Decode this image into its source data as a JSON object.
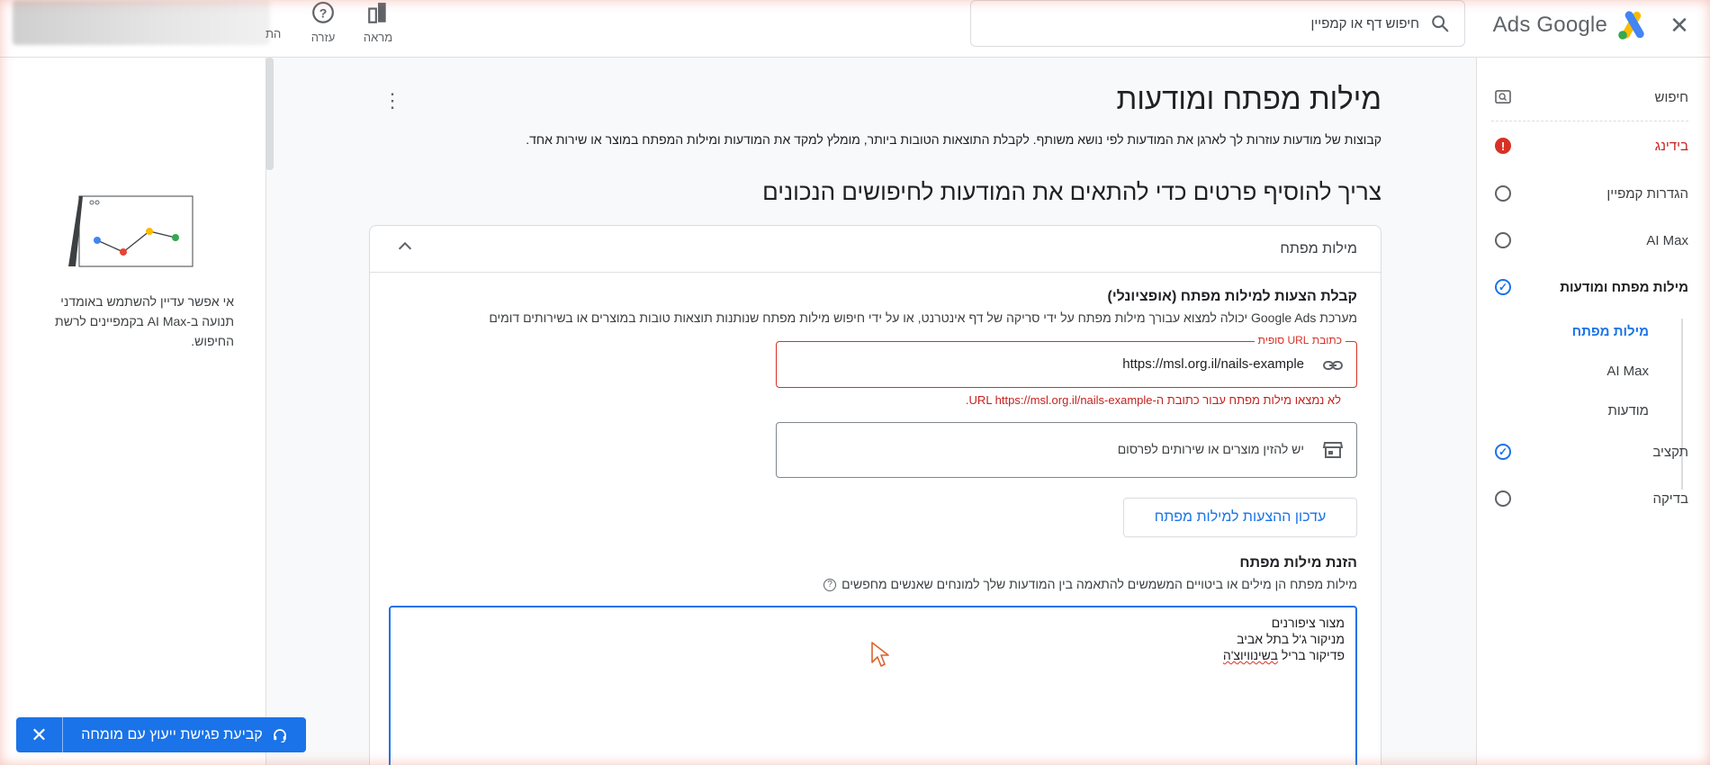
{
  "header": {
    "brand": "Ads Google",
    "search_placeholder": "חיפוש דף או קמפיין",
    "tools": {
      "appearance": "מראה",
      "help": "עזרה",
      "notifications_cut": "הת"
    }
  },
  "nav": {
    "items": [
      {
        "label": "חיפוש",
        "status": "search"
      },
      {
        "label": "בידינג",
        "status": "error"
      },
      {
        "label": "הגדרות קמפיין",
        "status": "empty"
      },
      {
        "label": "AI Max",
        "status": "empty"
      },
      {
        "label": "מילות מפתח ומודעות",
        "status": "done"
      },
      {
        "label": "תקציב",
        "status": "done"
      },
      {
        "label": "בדיקה",
        "status": "empty"
      }
    ],
    "sub_items": [
      "מילות מפתח",
      "AI Max",
      "מודעות"
    ]
  },
  "left_panel": {
    "text": "אי אפשר עדיין להשתמש באומדני תנועה ב-AI Max בקמפיינים לרשת החיפוש."
  },
  "main": {
    "title": "מילות מפתח ומודעות",
    "subtitle": "קבוצות של מודעות עוזרות לך לארגן את המודעות לפי נושא משותף. לקבלת התוצאות הטובות ביותר, מומלץ למקד את המודעות ומילות המפתח במוצר או שירות אחד.",
    "heading": "צריך להוסיף פרטים כדי להתאים את המודעות לחיפושים הנכונים",
    "card": {
      "title": "מילות מפתח",
      "suggest_title": "קבלת הצעות למילות מפתח (אופציונלי)",
      "suggest_desc": "מערכת Google Ads יכולה למצוא עבורך מילות מפתח על ידי סריקה של דף אינטרנט, או על ידי חיפוש מילות מפתח שנותנות תוצאות טובות במוצרים או בשירותים דומים",
      "url_label": "כתובת URL סופית",
      "url_value": "https://msl.org.il/nails-example",
      "url_error": "לא נמצאו מילות מפתח עבור כתובת ה-URL https://msl.org.il/nails-example.",
      "products_placeholder": "יש להזין מוצרים או שירותים לפרסום",
      "update_button": "עדכון ההצעות למילות מפתח",
      "enter_title": "הזנת מילות מפתח",
      "enter_desc": "מילות מפתח הן מילים או ביטויים המשמשים להתאמה בין המודעות שלך למונחים שאנשים מחפשים",
      "keywords": {
        "line1": "מצור ציפורנים",
        "line2": "מניקור ג'ל בתל אביב",
        "line3_a": "פדיקור בריל ",
        "line3_b": "בשינוויוצ'ה"
      }
    }
  },
  "consult": {
    "label": "קביעת פגישת ייעוץ עם מומחה"
  },
  "colors": {
    "accent": "#1a73e8",
    "error": "#d93025"
  }
}
